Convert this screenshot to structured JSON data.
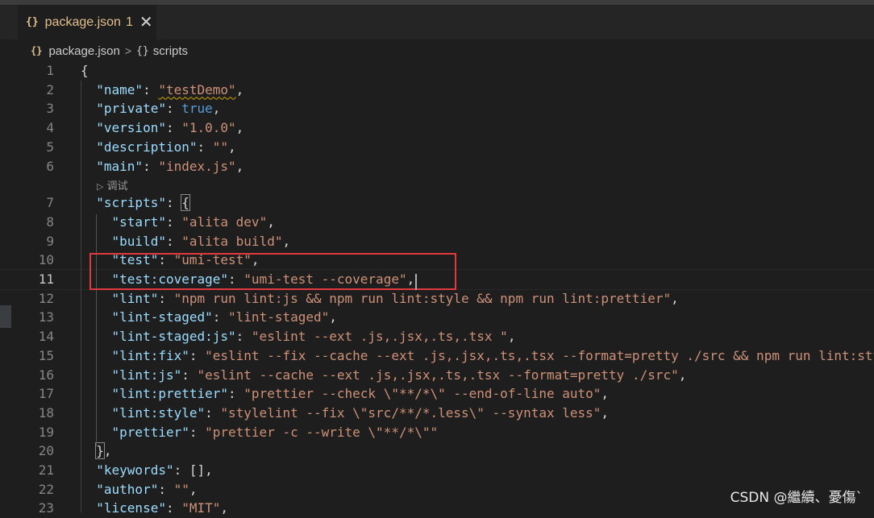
{
  "tab": {
    "icon": "{}",
    "filename": "package.json",
    "problems_badge": "1",
    "close_glyph": "✕"
  },
  "breadcrumb": {
    "file_icon": "{}",
    "file": "package.json",
    "separator": ">",
    "symbol_icon": "{}",
    "symbol": "scripts"
  },
  "codelens": {
    "icon": "▷",
    "label": "调试"
  },
  "editor": {
    "current_line": 11,
    "lines": [
      {
        "n": 1,
        "tokens": [
          [
            "p",
            "{"
          ]
        ]
      },
      {
        "n": 2,
        "tokens": [
          [
            "p",
            "  "
          ],
          [
            "k",
            "\"name\""
          ],
          [
            "p",
            ": "
          ],
          [
            "sq",
            "\"testDemo\""
          ],
          [
            "p",
            ","
          ]
        ]
      },
      {
        "n": 3,
        "tokens": [
          [
            "p",
            "  "
          ],
          [
            "k",
            "\"private\""
          ],
          [
            "p",
            ": "
          ],
          [
            "b",
            "true"
          ],
          [
            "p",
            ","
          ]
        ]
      },
      {
        "n": 4,
        "tokens": [
          [
            "p",
            "  "
          ],
          [
            "k",
            "\"version\""
          ],
          [
            "p",
            ": "
          ],
          [
            "s",
            "\"1.0.0\""
          ],
          [
            "p",
            ","
          ]
        ]
      },
      {
        "n": 5,
        "tokens": [
          [
            "p",
            "  "
          ],
          [
            "k",
            "\"description\""
          ],
          [
            "p",
            ": "
          ],
          [
            "s",
            "\"\""
          ],
          [
            "p",
            ","
          ]
        ]
      },
      {
        "n": 6,
        "tokens": [
          [
            "p",
            "  "
          ],
          [
            "k",
            "\"main\""
          ],
          [
            "p",
            ": "
          ],
          [
            "s",
            "\"index.js\""
          ],
          [
            "p",
            ","
          ]
        ]
      },
      {
        "n": 7,
        "tokens": [
          [
            "p",
            "  "
          ],
          [
            "k",
            "\"scripts\""
          ],
          [
            "p",
            ": "
          ],
          [
            "bb",
            "{"
          ]
        ]
      },
      {
        "n": 8,
        "tokens": [
          [
            "p",
            "    "
          ],
          [
            "k",
            "\"start\""
          ],
          [
            "p",
            ": "
          ],
          [
            "s",
            "\"alita dev\""
          ],
          [
            "p",
            ","
          ]
        ]
      },
      {
        "n": 9,
        "tokens": [
          [
            "p",
            "    "
          ],
          [
            "k",
            "\"build\""
          ],
          [
            "p",
            ": "
          ],
          [
            "s",
            "\"alita build\""
          ],
          [
            "p",
            ","
          ]
        ]
      },
      {
        "n": 10,
        "tokens": [
          [
            "p",
            "    "
          ],
          [
            "k",
            "\"test\""
          ],
          [
            "p",
            ": "
          ],
          [
            "s",
            "\"umi-test\""
          ],
          [
            "p",
            ","
          ]
        ]
      },
      {
        "n": 11,
        "tokens": [
          [
            "p",
            "    "
          ],
          [
            "k",
            "\"test:coverage\""
          ],
          [
            "p",
            ": "
          ],
          [
            "s",
            "\"umi-test --coverage\""
          ],
          [
            "p",
            ","
          ]
        ]
      },
      {
        "n": 12,
        "tokens": [
          [
            "p",
            "    "
          ],
          [
            "k",
            "\"lint\""
          ],
          [
            "p",
            ": "
          ],
          [
            "s",
            "\"npm run lint:js && npm run lint:style && npm run lint:prettier\""
          ],
          [
            "p",
            ","
          ]
        ]
      },
      {
        "n": 13,
        "tokens": [
          [
            "p",
            "    "
          ],
          [
            "k",
            "\"lint-staged\""
          ],
          [
            "p",
            ": "
          ],
          [
            "s",
            "\"lint-staged\""
          ],
          [
            "p",
            ","
          ]
        ]
      },
      {
        "n": 14,
        "tokens": [
          [
            "p",
            "    "
          ],
          [
            "k",
            "\"lint-staged:js\""
          ],
          [
            "p",
            ": "
          ],
          [
            "s",
            "\"eslint --ext .js,.jsx,.ts,.tsx \""
          ],
          [
            "p",
            ","
          ]
        ]
      },
      {
        "n": 15,
        "tokens": [
          [
            "p",
            "    "
          ],
          [
            "k",
            "\"lint:fix\""
          ],
          [
            "p",
            ": "
          ],
          [
            "s",
            "\"eslint --fix --cache --ext .js,.jsx,.ts,.tsx --format=pretty ./src && npm run lint:sty"
          ]
        ]
      },
      {
        "n": 16,
        "tokens": [
          [
            "p",
            "    "
          ],
          [
            "k",
            "\"lint:js\""
          ],
          [
            "p",
            ": "
          ],
          [
            "s",
            "\"eslint --cache --ext .js,.jsx,.ts,.tsx --format=pretty ./src\""
          ],
          [
            "p",
            ","
          ]
        ]
      },
      {
        "n": 17,
        "tokens": [
          [
            "p",
            "    "
          ],
          [
            "k",
            "\"lint:prettier\""
          ],
          [
            "p",
            ": "
          ],
          [
            "s",
            "\"prettier --check \\\"**/*\\\" --end-of-line auto\""
          ],
          [
            "p",
            ","
          ]
        ]
      },
      {
        "n": 18,
        "tokens": [
          [
            "p",
            "    "
          ],
          [
            "k",
            "\"lint:style\""
          ],
          [
            "p",
            ": "
          ],
          [
            "s",
            "\"stylelint --fix \\\"src/**/*.less\\\" --syntax less\""
          ],
          [
            "p",
            ","
          ]
        ]
      },
      {
        "n": 19,
        "tokens": [
          [
            "p",
            "    "
          ],
          [
            "k",
            "\"prettier\""
          ],
          [
            "p",
            ": "
          ],
          [
            "s",
            "\"prettier -c --write \\\"**/*\\\"\""
          ]
        ]
      },
      {
        "n": 20,
        "tokens": [
          [
            "p",
            "  "
          ],
          [
            "bb",
            "}"
          ],
          [
            "p",
            ","
          ]
        ]
      },
      {
        "n": 21,
        "tokens": [
          [
            "p",
            "  "
          ],
          [
            "k",
            "\"keywords\""
          ],
          [
            "p",
            ": [],"
          ]
        ]
      },
      {
        "n": 22,
        "tokens": [
          [
            "p",
            "  "
          ],
          [
            "k",
            "\"author\""
          ],
          [
            "p",
            ": "
          ],
          [
            "s",
            "\"\""
          ],
          [
            "p",
            ","
          ]
        ]
      },
      {
        "n": 23,
        "tokens": [
          [
            "p",
            "  "
          ],
          [
            "k",
            "\"license\""
          ],
          [
            "p",
            ": "
          ],
          [
            "s",
            "\"MIT\""
          ],
          [
            "p",
            ","
          ]
        ]
      }
    ]
  },
  "watermark": "CSDN @繼續、憂傷`",
  "colors": {
    "background": "#1e1e1e",
    "key": "#9cdcfe",
    "string": "#ce9178",
    "boolean": "#569cd6",
    "highlight_box": "#e0393e"
  }
}
